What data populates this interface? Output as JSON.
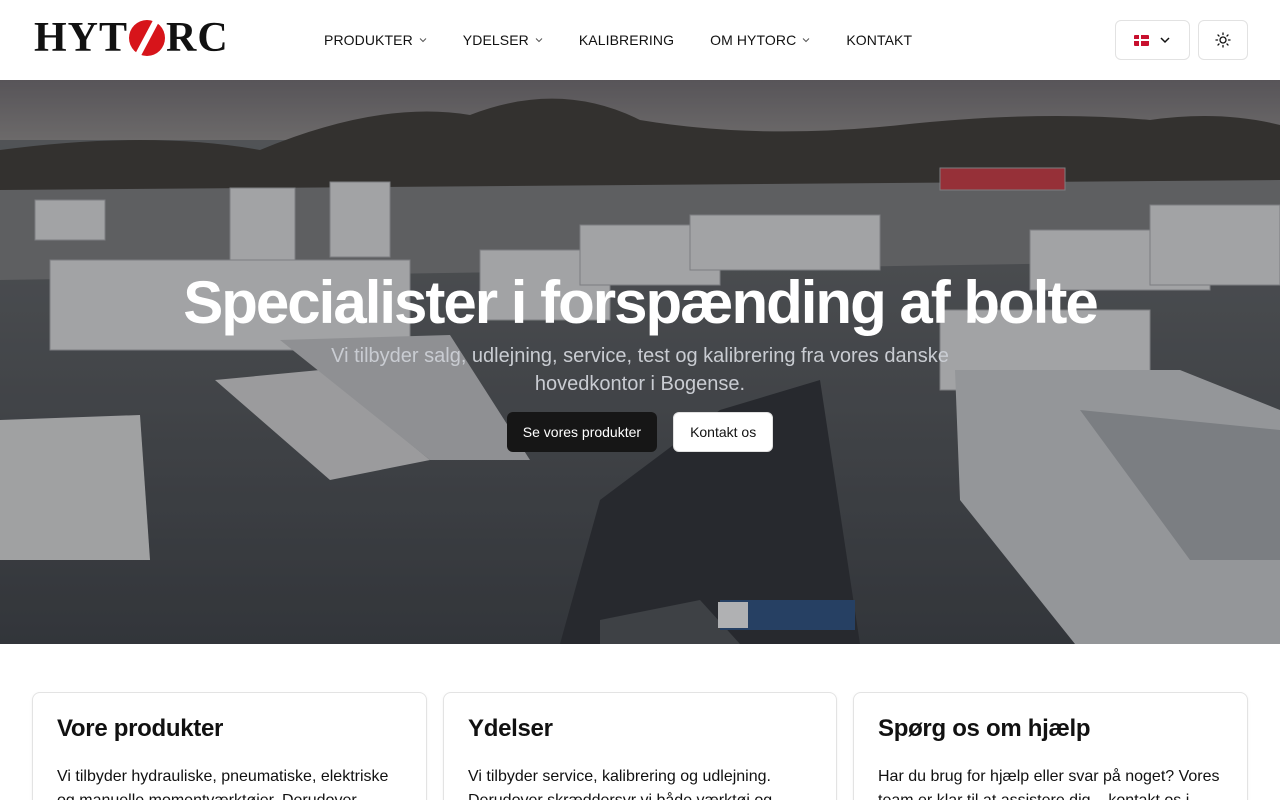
{
  "header": {
    "logo_text_left": "HYT",
    "logo_text_right": "RC",
    "nav": [
      {
        "label": "PRODUKTER",
        "dropdown": true
      },
      {
        "label": "YDELSER",
        "dropdown": true
      },
      {
        "label": "KALIBRERING",
        "dropdown": false
      },
      {
        "label": "OM HYTORC",
        "dropdown": true
      },
      {
        "label": "KONTAKT",
        "dropdown": false
      }
    ],
    "language_icon": "denmark-flag-icon",
    "theme_icon": "sun-icon"
  },
  "hero": {
    "title": "Specialister i forspænding af bolte",
    "subtitle": "Vi tilbyder salg, udlejning, service, test og kalibrering fra vores danske hovedkontor i Bogense.",
    "primary_button": "Se vores produkter",
    "secondary_button": "Kontakt os"
  },
  "cards": [
    {
      "title": "Vore produkter",
      "text": "Vi tilbyder hydrauliske, pneumatiske, elektriske og manuelle momentværktøjer. Derudover leverer"
    },
    {
      "title": "Ydelser",
      "text": "Vi tilbyder service, kalibrering og udlejning. Derudover skræddersyr vi både værktøj og"
    },
    {
      "title": "Spørg os om hjælp",
      "text": "Har du brug for hjælp eller svar på noget? Vores team er klar til at assistere dig – kontakt os i"
    }
  ],
  "colors": {
    "brand_red": "#d7141a",
    "button_dark": "#161616"
  }
}
